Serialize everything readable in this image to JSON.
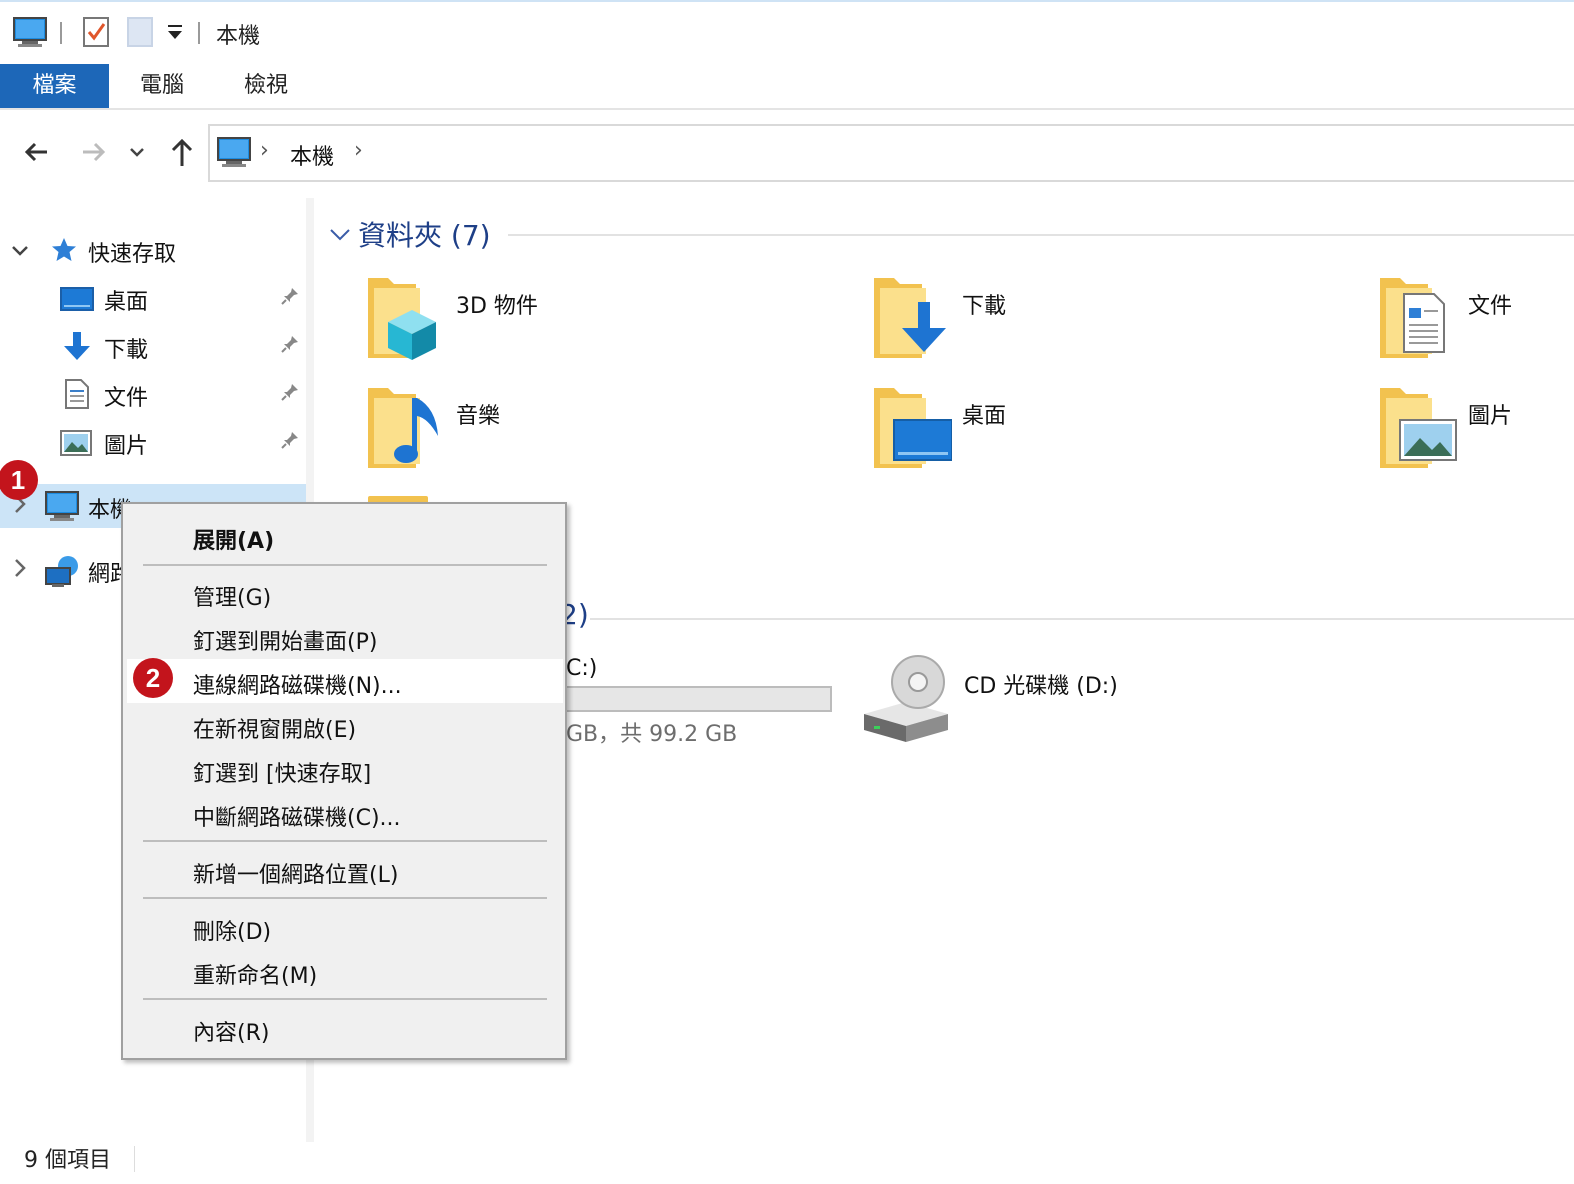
{
  "window": {
    "title": "本機"
  },
  "ribbon": {
    "tabs": [
      {
        "label": "檔案"
      },
      {
        "label": "電腦"
      },
      {
        "label": "檢視"
      }
    ]
  },
  "address": {
    "crumb": "本機"
  },
  "sidebar": {
    "quick_access": {
      "label": "快速存取",
      "items": [
        {
          "label": "桌面"
        },
        {
          "label": "下載"
        },
        {
          "label": "文件"
        },
        {
          "label": "圖片"
        }
      ]
    },
    "this_pc": {
      "label": "本機"
    },
    "network": {
      "label": "網路"
    }
  },
  "content": {
    "folders_header": "資料夾 (7)",
    "folders": [
      {
        "name": "3D 物件",
        "icon": "3d-objects-folder-icon"
      },
      {
        "name": "下載",
        "icon": "downloads-folder-icon"
      },
      {
        "name": "文件",
        "icon": "documents-folder-icon"
      },
      {
        "name": "音樂",
        "icon": "music-folder-icon"
      },
      {
        "name": "桌面",
        "icon": "desktop-folder-icon"
      },
      {
        "name": "圖片",
        "icon": "pictures-folder-icon"
      }
    ],
    "devices_header_partial": "2)",
    "drive_c": {
      "name_partial": "C:)",
      "free_partial": "GB，共 99.2 GB"
    },
    "drive_d": {
      "name": "CD 光碟機 (D:)"
    }
  },
  "context_menu": {
    "items": [
      {
        "label": "展開(A)"
      },
      {
        "label": "管理(G)"
      },
      {
        "label": "釘選到開始畫面(P)"
      },
      {
        "label": "連線網路磁碟機(N)..."
      },
      {
        "label": "在新視窗開啟(E)"
      },
      {
        "label": "釘選到 [快速存取]"
      },
      {
        "label": "中斷網路磁碟機(C)..."
      },
      {
        "label": "新增一個網路位置(L)"
      },
      {
        "label": "刪除(D)"
      },
      {
        "label": "重新命名(M)"
      },
      {
        "label": "內容(R)"
      }
    ]
  },
  "annotations": {
    "badge1": "1",
    "badge2": "2"
  },
  "status": {
    "items_count": "9 個項目"
  },
  "colors": {
    "accent": "#1d67b8",
    "selection": "#cce4f7",
    "badge": "#c3141c",
    "folder": "#f2c24f"
  }
}
